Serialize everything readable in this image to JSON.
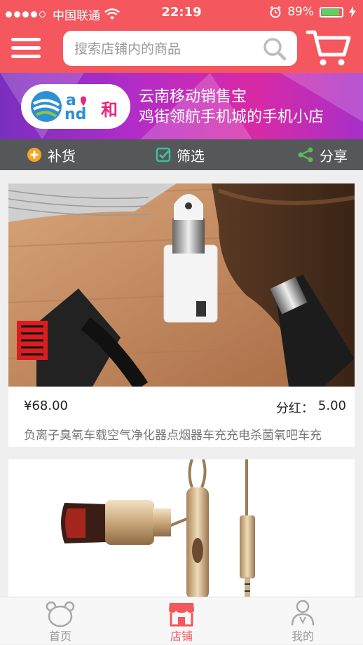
{
  "status_bar": {
    "carrier": "中国联通",
    "time": "22:19",
    "battery": "89%",
    "battery_level": 0.89
  },
  "header": {
    "search_placeholder": "搜索店铺内的商品"
  },
  "banner": {
    "logo_text": "和",
    "line1": "云南移动销售宝",
    "line2": "鸡街领航手机城的手机小店"
  },
  "toolbar": {
    "items": [
      {
        "label": "补货",
        "icon": "plus-circle-icon"
      },
      {
        "label": "筛选",
        "icon": "checkbox-icon"
      },
      {
        "label": "分享",
        "icon": "share-icon"
      }
    ]
  },
  "products": [
    {
      "price": "¥68.00",
      "commission_label": "分红：",
      "commission_value": "5.00",
      "name": "负离子臭氧车载空气净化器点烟器车充充电杀菌氧吧车充"
    }
  ],
  "tabbar": {
    "items": [
      {
        "label": "首页",
        "icon": "bear-home-icon",
        "active": false
      },
      {
        "label": "店铺",
        "icon": "store-icon",
        "active": true
      },
      {
        "label": "我的",
        "icon": "user-icon",
        "active": false
      }
    ]
  },
  "colors": {
    "brand": "#f4575d",
    "toolbar": "#555759",
    "plus_icon": "#f5a623",
    "check_icon": "#3cc0a0",
    "share_icon": "#5cb85c"
  }
}
